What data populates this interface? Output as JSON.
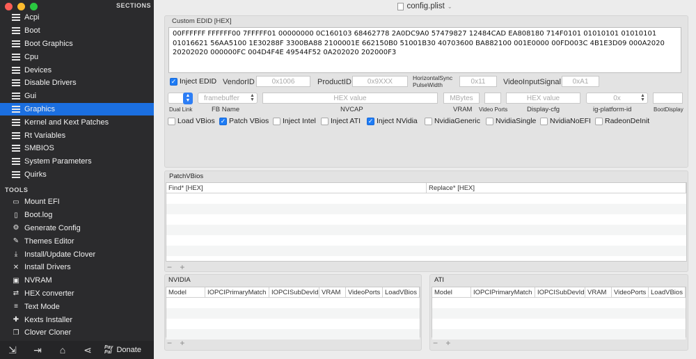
{
  "window": {
    "title": "config.plist"
  },
  "sidebar": {
    "sections_header": "SECTIONS",
    "sections": [
      {
        "label": "Acpi"
      },
      {
        "label": "Boot"
      },
      {
        "label": "Boot Graphics"
      },
      {
        "label": "Cpu"
      },
      {
        "label": "Devices"
      },
      {
        "label": "Disable Drivers"
      },
      {
        "label": "Gui"
      },
      {
        "label": "Graphics",
        "active": true
      },
      {
        "label": "Kernel and Kext Patches"
      },
      {
        "label": "Rt Variables"
      },
      {
        "label": "SMBIOS"
      },
      {
        "label": "System Parameters"
      },
      {
        "label": "Quirks"
      }
    ],
    "tools_header": "TOOLS",
    "tools": [
      {
        "label": "Mount EFI",
        "icon": "drive-icon",
        "glyph": "▭"
      },
      {
        "label": "Boot.log",
        "icon": "document-icon",
        "glyph": "▯"
      },
      {
        "label": "Generate Config",
        "icon": "gear-icon",
        "glyph": "⚙"
      },
      {
        "label": "Themes Editor",
        "icon": "brush-icon",
        "glyph": "✎"
      },
      {
        "label": "Install/Update Clover",
        "icon": "download-icon",
        "glyph": "⤓"
      },
      {
        "label": "Install Drivers",
        "icon": "wrench-icon",
        "glyph": "✕"
      },
      {
        "label": "NVRAM",
        "icon": "chip-icon",
        "glyph": "▣"
      },
      {
        "label": "HEX converter",
        "icon": "convert-icon",
        "glyph": "⇄"
      },
      {
        "label": "Text Mode",
        "icon": "text-icon",
        "glyph": "≡"
      },
      {
        "label": "Kexts Installer",
        "icon": "puzzle-icon",
        "glyph": "✚"
      },
      {
        "label": "Clover Cloner",
        "icon": "clone-icon",
        "glyph": "❐"
      }
    ],
    "bottom": {
      "pp_line1": "Pay",
      "pp_line2": "Pal",
      "donate": "Donate"
    }
  },
  "graphics": {
    "custom_edid_label": "Custom EDID [HEX]",
    "custom_edid_value": "00FFFFFF FFFFFF00 7FFFFF01 00000000 0C160103 68462778 2A0DC9A0 57479827 12484CAD EA808180 714F0101 01010101 01010101 01016621 56AA5100 1E30288F 3300BA88 2100001E 662150B0 51001B30 40703600 BA882100 001E0000 00FD003C 4B1E3D09 000A2020 20202020 000000FC 004D4F4E 49544F52 0A202020 202000F3",
    "inject_edid": {
      "label": "Inject EDID",
      "checked": true
    },
    "vendor_id": {
      "label": "VendorID",
      "placeholder": "0x1006"
    },
    "product_id": {
      "label": "ProductID",
      "placeholder": "0x9XXX"
    },
    "hsync": {
      "label1": "HorizontalSync",
      "label2": "PulseWidth",
      "placeholder": "0x11"
    },
    "video_input": {
      "label": "VideoInputSignal",
      "placeholder": "0xA1"
    },
    "dual_link": {
      "label": "Dual Link"
    },
    "fb_name": {
      "label": "FB Name",
      "placeholder": "framebuffer"
    },
    "nvcap": {
      "label": "NVCAP",
      "placeholder": "HEX value"
    },
    "vram": {
      "label": "VRAM",
      "placeholder": "MBytes"
    },
    "video_ports": {
      "label": "Video Ports"
    },
    "display_cfg": {
      "label": "Display-cfg",
      "placeholder": "HEX value"
    },
    "ig_platform": {
      "label": "ig-platform-id",
      "placeholder": "0x"
    },
    "boot_display": {
      "label": "BootDisplay"
    },
    "checkboxes": [
      {
        "label": "Load VBios",
        "checked": false
      },
      {
        "label": "Patch VBios",
        "checked": true
      },
      {
        "label": "Inject Intel",
        "checked": false
      },
      {
        "label": "Inject ATI",
        "checked": false
      },
      {
        "label": "Inject NVidia",
        "checked": true
      },
      {
        "label": "NvidiaGeneric",
        "checked": false
      },
      {
        "label": "NvidiaSingle",
        "checked": false
      },
      {
        "label": "NvidiaNoEFI",
        "checked": false
      },
      {
        "label": "RadeonDeInit",
        "checked": false
      }
    ],
    "patch_vbios": {
      "label": "PatchVBios",
      "columns": [
        "Find* [HEX]",
        "Replace* [HEX]"
      ]
    },
    "nvidia": {
      "label": "NVIDIA",
      "columns": [
        "Model",
        "IOPCIPrimaryMatch",
        "IOPCISubDevId",
        "VRAM",
        "VideoPorts",
        "LoadVBios"
      ]
    },
    "ati": {
      "label": "ATI",
      "columns": [
        "Model",
        "IOPCIPrimaryMatch",
        "IOPCISubDevId",
        "VRAM",
        "VideoPorts",
        "LoadVBios"
      ]
    },
    "add_remove": "− +"
  },
  "colors": {
    "sidebar_bg": "#2b2b2d",
    "accent": "#1b6fe0",
    "checkbox_on": "#1e7cf5"
  }
}
